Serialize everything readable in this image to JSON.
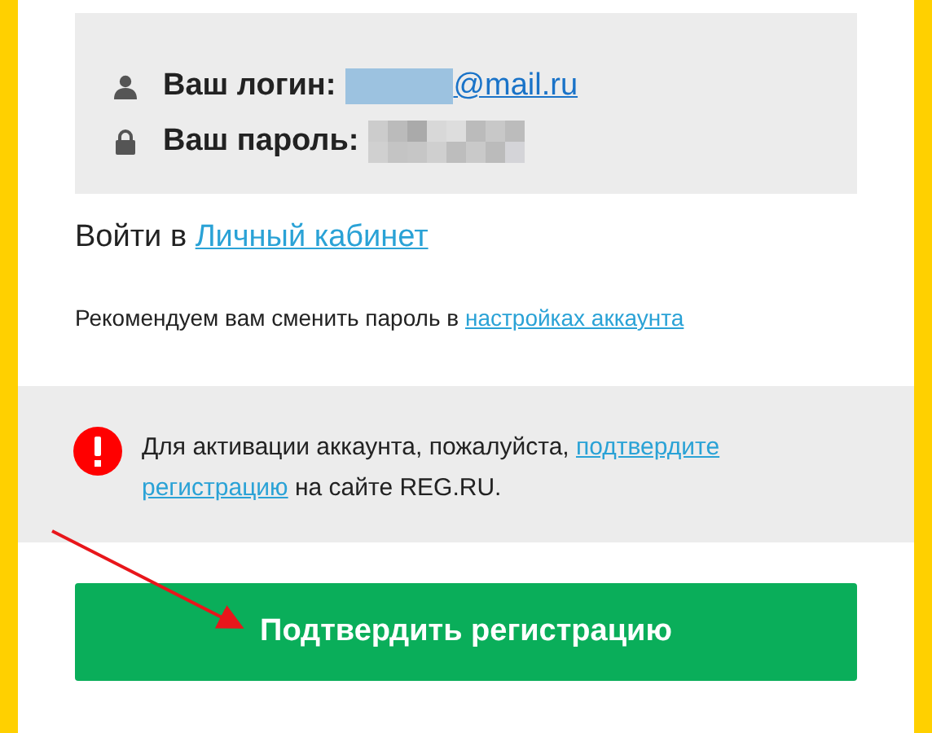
{
  "credentials": [
    {
      "kind": "login",
      "label": "Ваш логин:",
      "value": "@mail.ru"
    },
    {
      "kind": "password",
      "label": "Ваш пароль:"
    }
  ],
  "login_line": {
    "text": "Войти в",
    "link": "Личный кабинет"
  },
  "recommendation": {
    "text": "Рекомендуем вам сменить пароль в",
    "link": "настройках аккаунта"
  },
  "alert": {
    "before": "Для активации аккаунта, пожалуйста,",
    "link_parts": [
      "подтвердите",
      "регистрацию"
    ],
    "after": "на сайте REG.RU."
  },
  "confirm_button": "Подтвердить регистрацию"
}
